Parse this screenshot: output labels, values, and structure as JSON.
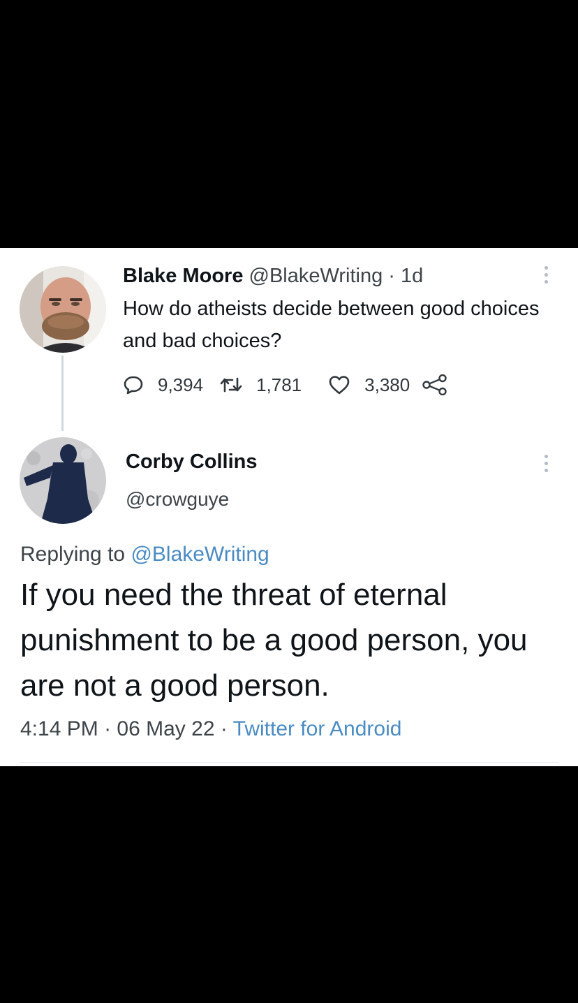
{
  "tweet": {
    "author_name": "Blake Moore",
    "author_handle": "@BlakeWriting",
    "separator": "·",
    "age": "1d",
    "text": "How do atheists decide between good choices and bad choices?",
    "reply_count": "9,394",
    "retweet_count": "1,781",
    "like_count": "3,380"
  },
  "reply": {
    "author_name": "Corby Collins",
    "author_handle": "@crowguye",
    "replying_label": "Replying to",
    "replying_to": "@BlakeWriting",
    "text": "If you need the threat of eternal punishment to be a good person, you are not a good person.",
    "time": "4:14 PM",
    "separator": "·",
    "date": "06 May 22",
    "source": "Twitter for Android"
  },
  "icons": {
    "reply": "reply-icon",
    "retweet": "retweet-icon",
    "like": "heart-icon",
    "share": "share-icon",
    "more": "more-vertical-icon"
  },
  "colors": {
    "link": "#4a8bc3",
    "text": "#0f1419",
    "secondary": "#3d4449",
    "thread_line": "#cfd9de",
    "background": "#ffffff",
    "frame": "#000000"
  }
}
